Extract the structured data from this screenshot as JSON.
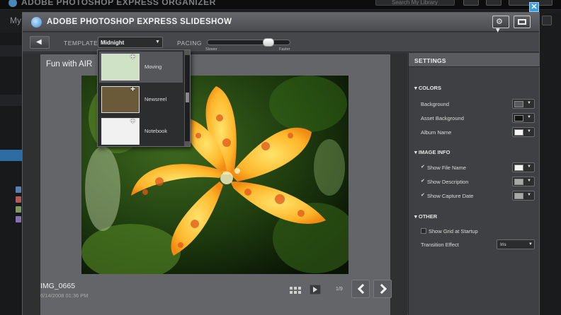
{
  "background_app": {
    "title": "ADOBE PHOTOSHOP EXPRESS ORGANIZER",
    "section_label": "My",
    "search_placeholder": "Search My Library",
    "logo_icon": "photoshop-express-logo-icon"
  },
  "dialog": {
    "title": "ADOBE PHOTOSHOP EXPRESS SLIDESHOW",
    "icons": {
      "logo": "photoshop-express-logo-icon",
      "gear": "gear-icon",
      "fullscreen": "fullscreen-icon",
      "close": "close-icon",
      "close_glyph": "✕"
    }
  },
  "toolbar": {
    "back_icon": "back-arrow-icon",
    "template_label": "TEMPLATE",
    "template_value": "Midnight",
    "pacing_label": "PACING",
    "pacing_slower": "Slower",
    "pacing_faster": "Faster",
    "pacing_level": 0.78
  },
  "template_dropdown": {
    "items": [
      {
        "label": "Moving",
        "thumb_color": "#cfe2c6"
      },
      {
        "label": "Newsreel",
        "thumb_color": "#6b5a3a"
      },
      {
        "label": "Notebook",
        "thumb_color": "#f1f1f1"
      }
    ]
  },
  "slide": {
    "title": "Fun with AIR",
    "file_name": "IMG_0665",
    "capture_date": "6/14/2008 01:36 PM",
    "counter": "1/9",
    "controls": {
      "grid_icon": "grid-view-icon",
      "play_icon": "play-icon",
      "prev_icon": "chevron-left-icon",
      "next_icon": "chevron-right-icon"
    }
  },
  "settings": {
    "title": "SETTINGS",
    "colors": {
      "heading": "COLORS",
      "rows": [
        {
          "label": "Background",
          "color": "#5a5b5e"
        },
        {
          "label": "Asset Background",
          "color": "#141414"
        },
        {
          "label": "Album Name",
          "color": "#f4f4f4"
        }
      ]
    },
    "image_info": {
      "heading": "IMAGE INFO",
      "rows": [
        {
          "label": "Show File Name",
          "color": "#f4f4f4",
          "checked": true
        },
        {
          "label": "Show Description",
          "color": "#a8a8a8",
          "checked": true
        },
        {
          "label": "Show Capture Date",
          "color": "#a8a8a8",
          "checked": true
        }
      ]
    },
    "other": {
      "heading": "OTHER",
      "show_grid_label": "Show Grid at Startup",
      "show_grid_checked": false,
      "transition_label": "Transition Effect",
      "transition_value": "Iris"
    }
  },
  "colors": {
    "accent": "#3c9fd9",
    "panel": "#3f4043",
    "stage": "#646568"
  }
}
